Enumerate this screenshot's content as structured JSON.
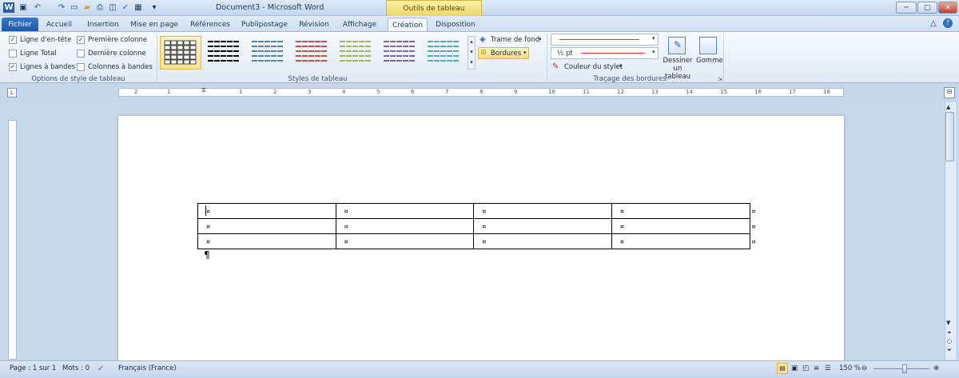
{
  "window": {
    "title": "Document3 - Microsoft Word",
    "context_title": "Outils de tableau"
  },
  "tabs": [
    "Fichier",
    "Accueil",
    "Insertion",
    "Mise en page",
    "Références",
    "Publipostage",
    "Révision",
    "Affichage",
    "Création",
    "Disposition"
  ],
  "style_options": {
    "items": [
      {
        "label": "Ligne d'en-tête",
        "checked": true
      },
      {
        "label": "Première colonne",
        "checked": true
      },
      {
        "label": "Ligne Total",
        "checked": false
      },
      {
        "label": "Dernière colonne",
        "checked": false
      },
      {
        "label": "Lignes à bandes",
        "checked": true
      },
      {
        "label": "Colonnes à bandes",
        "checked": false
      }
    ],
    "group_label": "Options de style de tableau"
  },
  "table_styles": {
    "group_label": "Styles de tableau",
    "colors": [
      "#000000",
      "#000000",
      "#4f81bd",
      "#c0504d",
      "#9bbb59",
      "#8064a2",
      "#4bacc6"
    ],
    "selected": 0
  },
  "shading": {
    "trame_label": "Trame de fond",
    "bordures_label": "Bordures"
  },
  "borders": {
    "line_width": "½ pt",
    "pen_color_label": "Couleur du stylet",
    "pen_color": "#e03030",
    "draw_label": "Dessiner un tableau",
    "eraser_label": "Gomme",
    "group_label": "Traçage des bordures"
  },
  "ruler": {
    "numbers": [
      "2",
      "1",
      "1",
      "2",
      "3",
      "4",
      "5",
      "6",
      "7",
      "8",
      "9",
      "10",
      "11",
      "12",
      "13",
      "14",
      "15",
      "16",
      "17",
      "18"
    ]
  },
  "document": {
    "rows": 3,
    "cols": 5,
    "cell_mark": "¤",
    "paragraph_mark": "¶"
  },
  "status": {
    "page": "Page : 1 sur 1",
    "words": "Mots : 0",
    "language": "Français (France)",
    "zoom": "150 %"
  }
}
